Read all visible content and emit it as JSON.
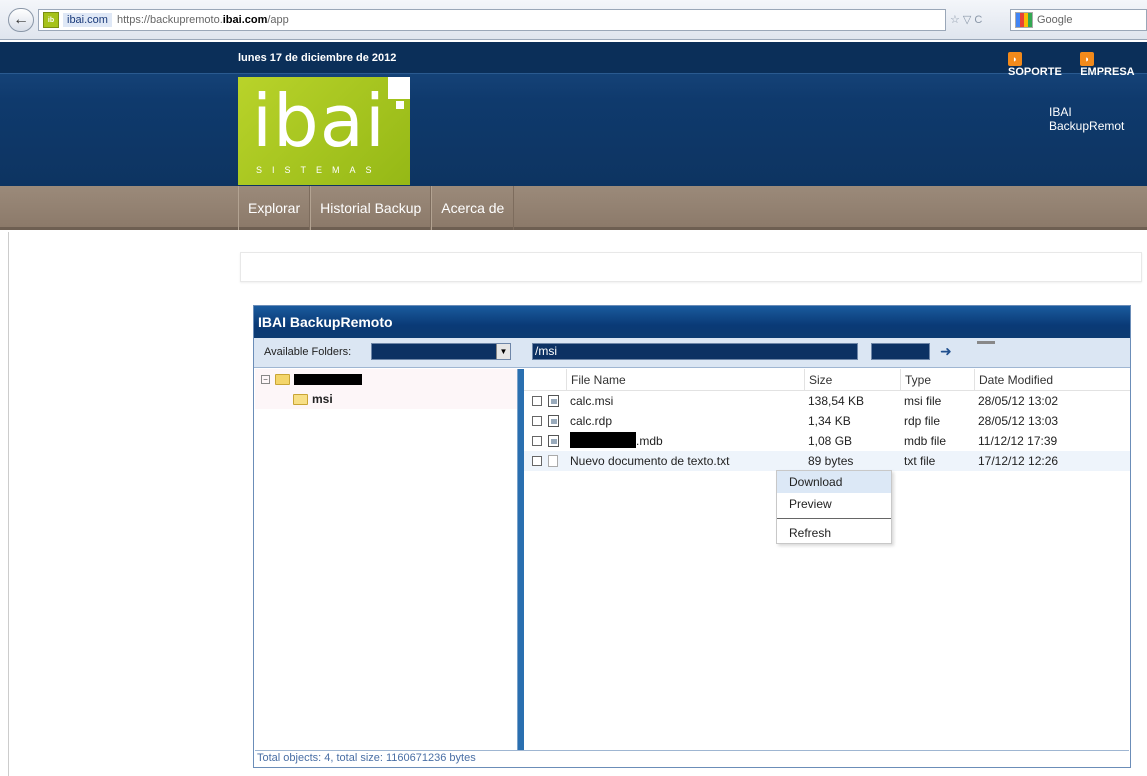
{
  "browser": {
    "back_label": "←",
    "site_label": "ibai.com",
    "url_prefix": "https://backupremoto.",
    "url_domain": "ibai.com",
    "url_path": "/app",
    "search_placeholder": "Google",
    "icons_text": "☆ ▽ C"
  },
  "header": {
    "date": "lunes 17 de diciembre de 2012",
    "link_support": "SOPORTE",
    "link_company": "EMPRESA",
    "logo_word": "ibai",
    "logo_sub": "SISTEMAS",
    "app_title": "IBAI BackupRemot"
  },
  "nav": {
    "items": [
      {
        "label": "Explorar"
      },
      {
        "label": "Historial Backup"
      },
      {
        "label": "Acerca de"
      }
    ]
  },
  "panel": {
    "title": "IBAI BackupRemoto",
    "available_folders_label": "Available Folders:",
    "path_value": "/msi",
    "tree": {
      "child_label": "msi"
    },
    "columns": {
      "name": "File Name",
      "size": "Size",
      "type": "Type",
      "date": "Date Modified"
    },
    "files": [
      {
        "name": "calc.msi",
        "size": "138,54 KB",
        "type": "msi file",
        "date": "28/05/12 13:02"
      },
      {
        "name": "calc.rdp",
        "size": "1,34 KB",
        "type": "rdp file",
        "date": "28/05/12 13:03"
      },
      {
        "name": ".mdb",
        "size": "1,08 GB",
        "type": "mdb file",
        "date": "11/12/12 17:39"
      },
      {
        "name": "Nuevo documento de texto.txt",
        "size": "89 bytes",
        "type": "txt file",
        "date": "17/12/12 12:26"
      }
    ],
    "context_menu": {
      "download": "Download",
      "preview": "Preview",
      "refresh": "Refresh"
    },
    "status": "Total objects: 4, total size: 1160671236 bytes"
  }
}
